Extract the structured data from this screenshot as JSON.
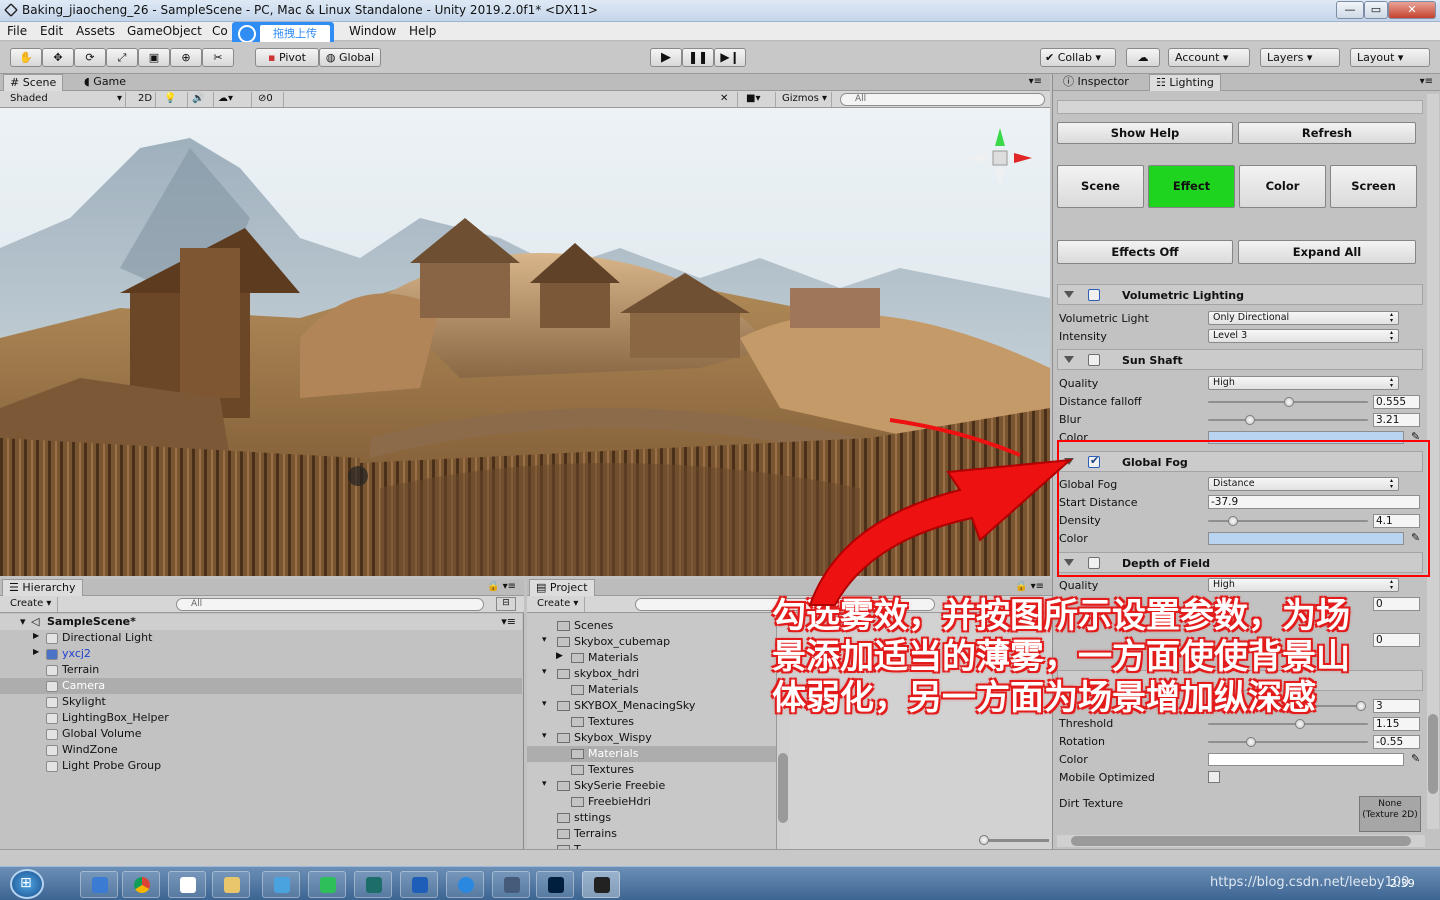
{
  "window": {
    "title": "Baking_jiaocheng_26 - SampleScene - PC, Mac & Linux Standalone - Unity 2019.2.0f1* <DX11>",
    "controls": [
      "—",
      "▭",
      "✕"
    ]
  },
  "upload_badge": "拖拽上传",
  "menu": [
    "File",
    "Edit",
    "Assets",
    "GameObject",
    "Co",
    "Window",
    "Help"
  ],
  "toolbar": {
    "pivot": "Pivot",
    "global": "Global",
    "collab": "Collab",
    "account": "Account",
    "layers": "Layers",
    "layout": "Layout"
  },
  "scene_view": {
    "tabs": [
      "Scene",
      "Game"
    ],
    "shading": "Shaded",
    "mode2d": "2D",
    "hidden_count": "0",
    "gizmos": "Gizmos",
    "search_placeholder": "All"
  },
  "inspector": {
    "tabs": [
      "Inspector",
      "Lighting"
    ],
    "buttons": {
      "show_help": "Show Help",
      "refresh": "Refresh",
      "scene": "Scene",
      "effect": "Effect",
      "color": "Color",
      "screen": "Screen",
      "effects_off": "Effects Off",
      "expand_all": "Expand All"
    },
    "active_color": "#1ed41e",
    "volumetric": {
      "title": "Volumetric Lighting",
      "light_label": "Volumetric Light",
      "light_value": "Only Directional",
      "intensity_label": "Intensity",
      "intensity_value": "Level 3"
    },
    "sun_shaft": {
      "title": "Sun Shaft",
      "quality_label": "Quality",
      "quality_value": "High",
      "falloff_label": "Distance falloff",
      "falloff_value": "0.555",
      "blur_label": "Blur",
      "blur_value": "3.21",
      "color_label": "Color"
    },
    "global_fog": {
      "title": "Global Fog",
      "enabled": true,
      "fog_label": "Global Fog",
      "fog_value": "Distance",
      "start_label": "Start Distance",
      "start_value": "-37.9",
      "density_label": "Density",
      "density_value": "4.1",
      "color_label": "Color"
    },
    "dof": {
      "title": "Depth of Field",
      "quality_label": "Quality",
      "quality_value": "High",
      "v1": "0",
      "v2": "0"
    },
    "bloom": {
      "v3": "3",
      "threshold_label": "Threshold",
      "threshold_value": "1.15",
      "rotation_label": "Rotation",
      "rotation_value": "-0.55",
      "color_label": "Color",
      "mobile_label": "Mobile Optimized",
      "dirt_label": "Dirt Texture",
      "dirt_value": "None (Texture 2D)"
    }
  },
  "hierarchy": {
    "tab": "Hierarchy",
    "create": "Create",
    "search": "All",
    "scene": "SampleScene*",
    "items": [
      "Directional Light",
      "yxcj2",
      "Terrain",
      "Camera",
      "Skylight",
      "LightingBox_Helper",
      "Global Volume",
      "WindZone",
      "Light Probe Group"
    ]
  },
  "project": {
    "tab": "Project",
    "create": "Create",
    "items": [
      "Scenes",
      "Skybox_cubemap",
      "Materials",
      "skybox_hdri",
      "Materials",
      "SKYBOX_MenacingSky",
      "Textures",
      "Skybox_Wispy",
      "Materials",
      "Textures",
      "SkySerie Freebie",
      "FreebieHdri",
      "sttings",
      "Terrains",
      "T..."
    ]
  },
  "annotation": {
    "lines": [
      "勾选雾效，并按图所示设置参数，为场",
      "景添加适当的薄雾，一方面使使背景山",
      "体弱化，另一方面为场景增加纵深感"
    ]
  },
  "watermark": "https://blog.csdn.net/leeby100",
  "clock": "2:39"
}
